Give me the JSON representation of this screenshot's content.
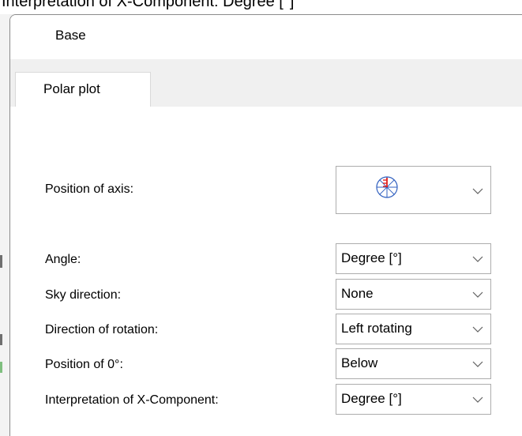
{
  "top_strip": {
    "partial_text": "Interpretation of X-Component: Degree [°]"
  },
  "dialog": {
    "title": "Base",
    "tabs": [
      {
        "label": "Polar plot",
        "active": true
      }
    ]
  },
  "fields": {
    "position_of_axis": {
      "label": "Position of axis:",
      "icon": "polar-axis-icon"
    },
    "angle": {
      "label": "Angle:",
      "value": "Degree [°]"
    },
    "sky_direction": {
      "label": "Sky direction:",
      "value": "None"
    },
    "direction_of_rotation": {
      "label": "Direction of rotation:",
      "value": "Left rotating"
    },
    "position_of_0": {
      "label": "Position of 0°:",
      "value": "Below"
    },
    "interpretation_x": {
      "label": "Interpretation of X-Component:",
      "value": "Degree [°]"
    }
  },
  "colors": {
    "icon_circle": "#2f5fbf",
    "icon_marker": "#e0201c"
  }
}
